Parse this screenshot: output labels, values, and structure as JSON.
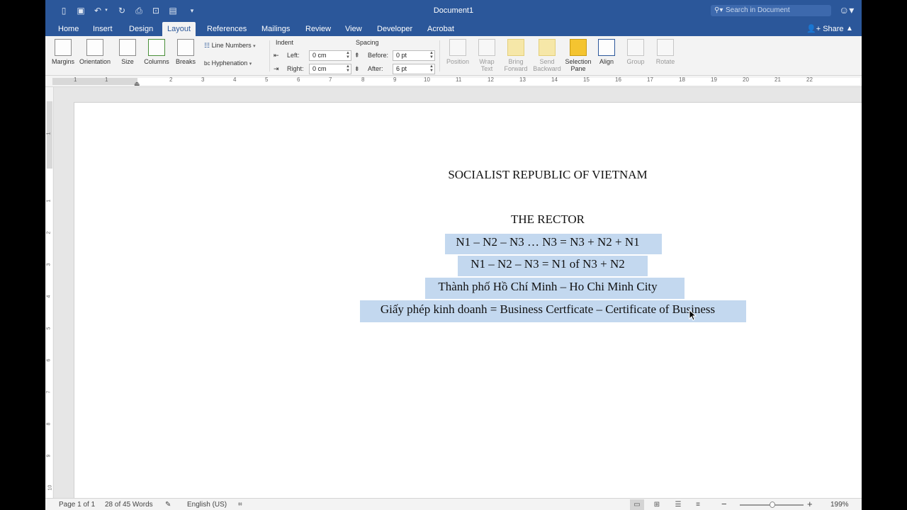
{
  "window": {
    "title": "Document1",
    "search_placeholder": "Search in Document"
  },
  "tabs": [
    "Home",
    "Insert",
    "Design",
    "Layout",
    "References",
    "Mailings",
    "Review",
    "View",
    "Developer",
    "Acrobat"
  ],
  "active_tab": "Layout",
  "share_label": "Share",
  "ribbon": {
    "margins": "Margins",
    "orientation": "Orientation",
    "size": "Size",
    "columns": "Columns",
    "breaks": "Breaks",
    "line_numbers": "Line Numbers",
    "hyphenation": "Hyphenation",
    "indent": {
      "label": "Indent",
      "left_label": "Left:",
      "left_value": "0 cm",
      "right_label": "Right:",
      "right_value": "0 cm"
    },
    "spacing": {
      "label": "Spacing",
      "before_label": "Before:",
      "before_value": "0 pt",
      "after_label": "After:",
      "after_value": "6 pt"
    },
    "position": "Position",
    "wrap_text_1": "Wrap",
    "wrap_text_2": "Text",
    "bring_forward_1": "Bring",
    "bring_forward_2": "Forward",
    "send_backward_1": "Send",
    "send_backward_2": "Backward",
    "selection_pane_1": "Selection",
    "selection_pane_2": "Pane",
    "align": "Align",
    "group": "Group",
    "rotate": "Rotate"
  },
  "ruler_numbers": [
    "1",
    "1",
    "2",
    "3",
    "4",
    "5",
    "6",
    "7",
    "8",
    "9",
    "10",
    "11",
    "12",
    "13",
    "14",
    "15",
    "16",
    "17",
    "18",
    "19",
    "20",
    "21",
    "22"
  ],
  "vruler_numbers": [
    "1",
    "1",
    "2",
    "3",
    "4",
    "5",
    "6",
    "7",
    "8",
    "9",
    "10"
  ],
  "document": {
    "line1": "SOCIALIST REPUBLIC OF VIETNAM",
    "line2": "THE RECTOR",
    "line3": "N1 – N2 – N3 … N3 = N3 + N2 + N1",
    "line4": "N1 – N2 – N3 = N1 of N3 + N2",
    "line5": "Thành phố Hồ Chí Minh – Ho Chi Minh City",
    "line6": "Giấy phép kinh doanh = Business Certficate – Certificate of Business"
  },
  "status": {
    "page": "Page 1 of 1",
    "words": "28 of 45 Words",
    "language": "English (US)",
    "zoom": "199%"
  },
  "colors": {
    "accent": "#2b579a",
    "selection": "#c3d8ef"
  }
}
